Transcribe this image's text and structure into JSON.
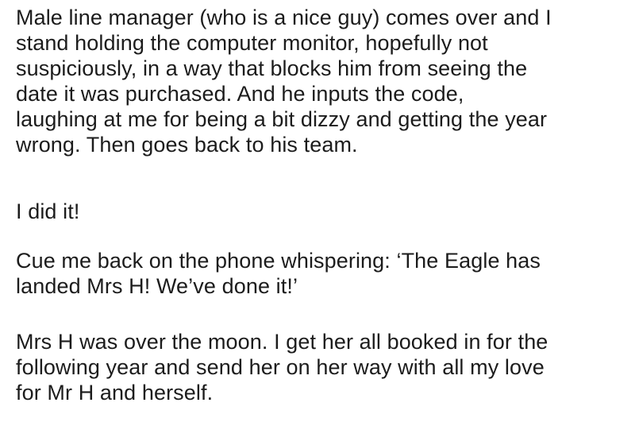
{
  "paragraphs": [
    {
      "lines": [
        "Male line manager (who is a nice guy) comes over and I",
        "stand holding the computer monitor, hopefully not",
        "suspiciously, in a way that blocks him from seeing the",
        "date it was purchased. And he inputs the code,",
        "laughing at me for being a bit dizzy and getting the year",
        "wrong. Then goes back to his team."
      ]
    },
    {
      "lines": [
        "I did it!"
      ]
    },
    {
      "lines": [
        "Cue me back on the phone whispering: ‘The Eagle has",
        "landed Mrs H! We’ve done it!’"
      ]
    },
    {
      "lines": [
        "Mrs H was over the moon. I get her all booked in for the",
        "following year and send her on her way with all my love",
        "for Mr H and herself."
      ]
    }
  ]
}
